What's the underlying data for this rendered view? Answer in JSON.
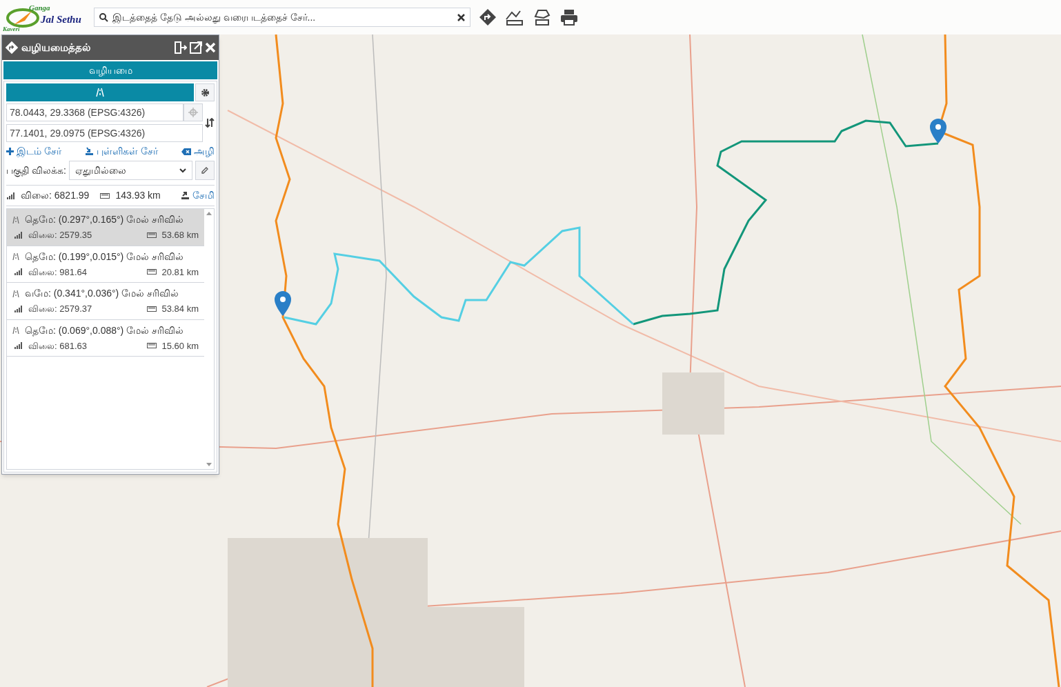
{
  "logo": {
    "top": "Ganga",
    "main": "Jal Sethu",
    "bottom": "Kaveri"
  },
  "search": {
    "placeholder": "இடத்தைத் தேடு அல்லது வரைபடத்தைச் சேர்..."
  },
  "panel": {
    "title": "வழியமைத்தல்",
    "tab": "வழியமை",
    "from": "78.0443, 29.3368 (EPSG:4326)",
    "to": "77.1401, 29.0975 (EPSG:4326)",
    "links": [
      "இடம் சேர்",
      "புள்ளிகள் சேர்",
      "அழி"
    ],
    "filter_label": "பகுதி விலக்க:",
    "filter_value": "ஏதுமில்லை",
    "summary": {
      "cost": "விலை: 6821.99",
      "distance": "143.93 km",
      "save": "சேமி"
    },
    "steps": [
      {
        "text": "தெமே: (0.297°,0.165°) மேல் சரிவில்",
        "cost": "விலை: 2579.35",
        "distance": "53.68 km",
        "selected": true
      },
      {
        "text": "தெமே: (0.199°,0.015°) மேல் சரிவில்",
        "cost": "விலை: 981.64",
        "distance": "20.81 km",
        "selected": false
      },
      {
        "text": "வமே: (0.341°,0.036°) மேல் சரிவில்",
        "cost": "விலை: 2579.37",
        "distance": "53.84 km",
        "selected": false
      },
      {
        "text": "தெமே: (0.069°,0.088°) மேல் சரிவில்",
        "cost": "விலை: 681.63",
        "distance": "15.60 km",
        "selected": false
      }
    ]
  }
}
